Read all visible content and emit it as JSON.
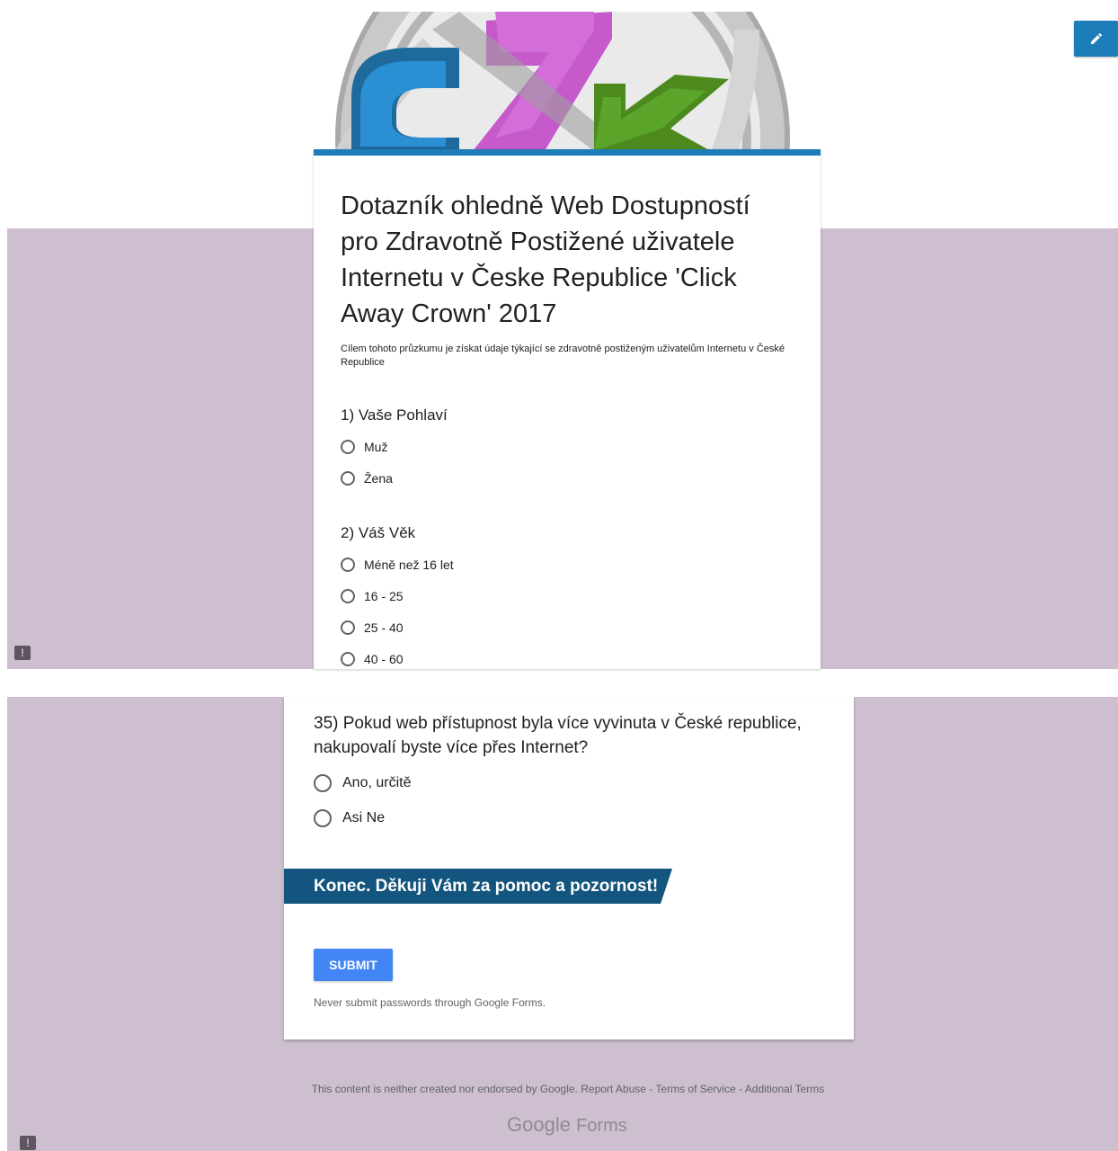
{
  "form": {
    "title": "Dotazník ohledně Web Dostupností pro Zdravotně Postižené uživatele Internetu v Česke Republice 'Click Away Crown' 2017",
    "description": "Cílem tohoto průzkumu je získat údaje týkající se zdravotně postiženým uživatelům Internetu v České Republice"
  },
  "questions": {
    "q1": {
      "title": "1) Vaše Pohlaví",
      "options": [
        "Muž",
        "Žena"
      ]
    },
    "q2": {
      "title": "2) Váš Věk",
      "options": [
        "Méně než 16 let",
        "16 - 25",
        "25 - 40",
        "40 - 60"
      ]
    },
    "q35": {
      "title": "35) Pokud web přístupnost byla více vyvinuta v České republice, nakupovalí byste více přes Internet?",
      "options": [
        "Ano, určitě",
        "Asi Ne"
      ]
    }
  },
  "section": {
    "title": "Konec. Děkuji Vám za pomoc a pozornost!"
  },
  "submit": {
    "label": "SUBMIT"
  },
  "warning": "Never submit passwords through Google Forms.",
  "footer": {
    "disclaimer": "This content is neither created nor endorsed by Google.",
    "report_abuse": "Report Abuse",
    "terms": "Terms of Service",
    "additional_terms": "Additional Terms",
    "separator": " - ",
    "brand_google": "Google",
    "brand_forms": "Forms"
  },
  "colors": {
    "theme": "#1c7db8",
    "background": "#cdbfcf",
    "section_banner": "#13557e",
    "submit": "#4285f4"
  },
  "icons": {
    "edit": "pencil-icon",
    "feedback": "feedback-icon"
  }
}
